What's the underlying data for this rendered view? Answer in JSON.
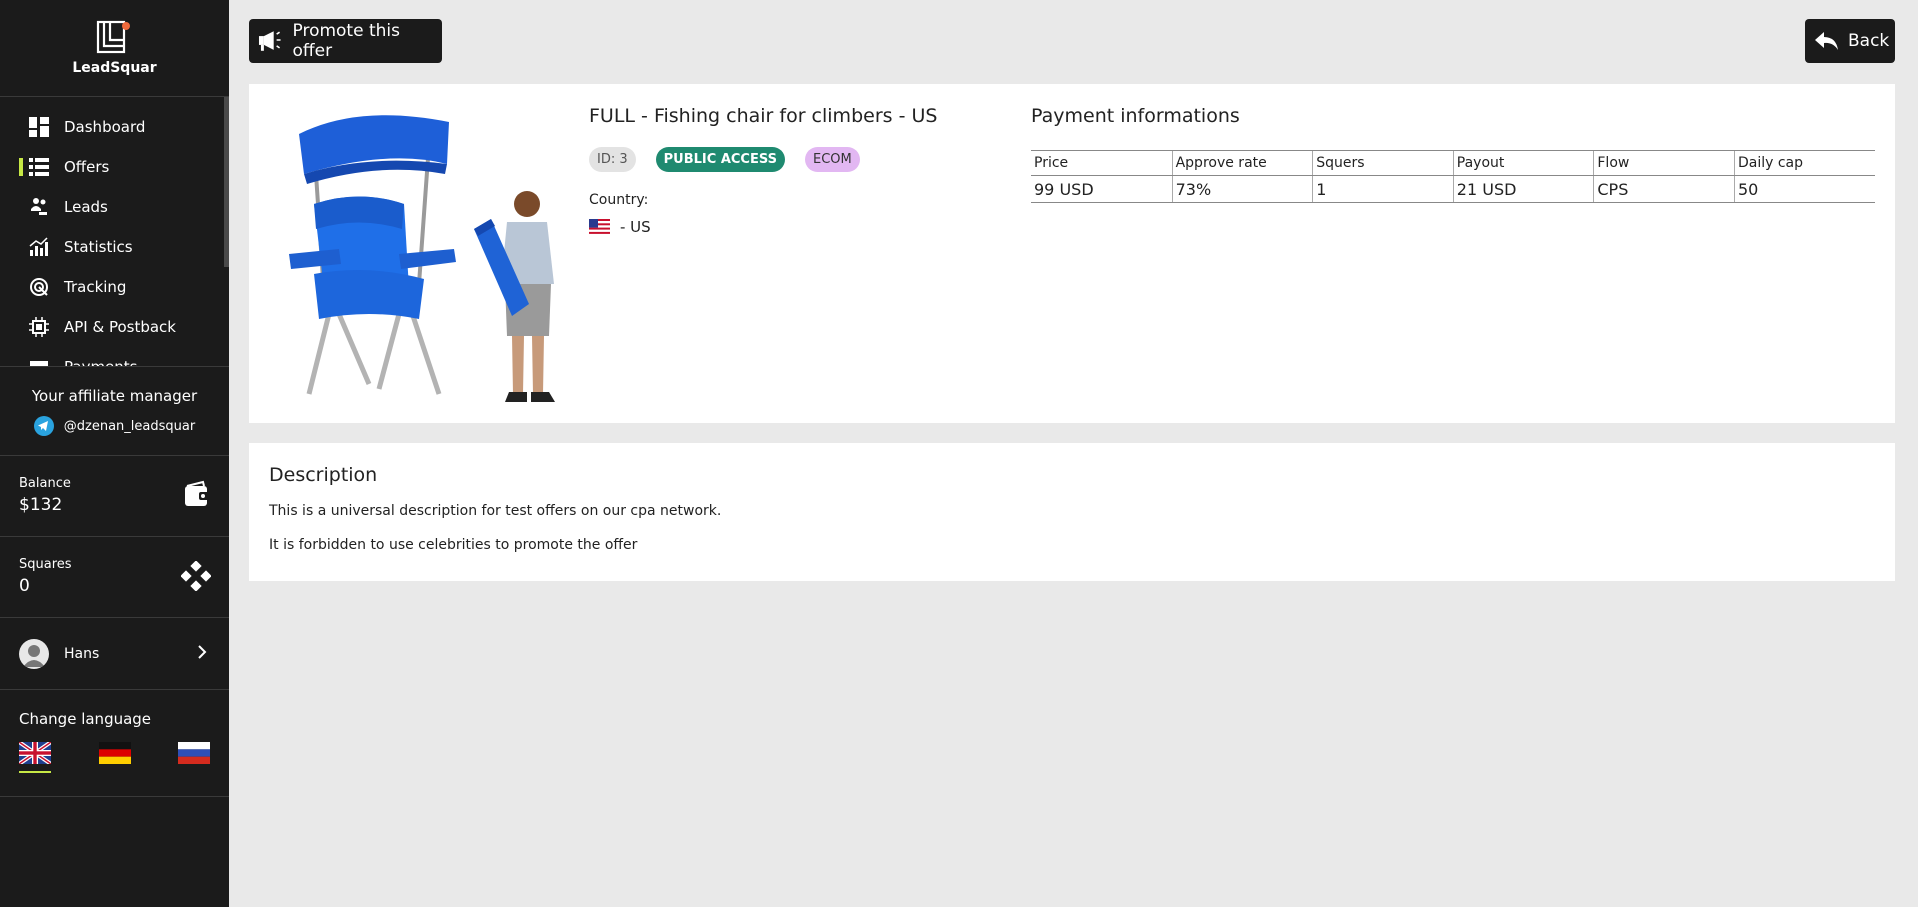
{
  "sidebar": {
    "brand": "LeadSquar",
    "nav": [
      {
        "label": "Dashboard",
        "icon": "dashboard-icon"
      },
      {
        "label": "Offers",
        "icon": "list-icon",
        "active": true
      },
      {
        "label": "Leads",
        "icon": "leads-icon"
      },
      {
        "label": "Statistics",
        "icon": "bar-chart-icon"
      },
      {
        "label": "Tracking",
        "icon": "tracking-icon"
      },
      {
        "label": "API & Postback",
        "icon": "api-icon"
      },
      {
        "label": "Payments",
        "icon": "payments-icon"
      }
    ],
    "manager": {
      "title": "Your affiliate manager",
      "contact": "@dzenan_leadsquar"
    },
    "balance": {
      "label": "Balance",
      "value": "$132"
    },
    "squares": {
      "label": "Squares",
      "value": "0"
    },
    "user": {
      "name": "Hans"
    },
    "language": {
      "title": "Change language",
      "options": [
        "en",
        "de",
        "ru"
      ],
      "active": "en"
    }
  },
  "toolbar": {
    "promote_label": "Promote this offer",
    "back_label": "Back"
  },
  "offer": {
    "title": "FULL - Fishing chair for climbers - US",
    "id_tag": "ID: 3",
    "access_tag": "PUBLIC ACCESS",
    "category_tag": "ECOM",
    "country_label": "Country:",
    "country_value": "- US"
  },
  "payment": {
    "title": "Payment informations",
    "headers": [
      "Price",
      "Approve rate",
      "Squers",
      "Payout",
      "Flow",
      "Daily cap"
    ],
    "values": [
      "99 USD",
      "73%",
      "1",
      "21 USD",
      "CPS",
      "50"
    ]
  },
  "description": {
    "title": "Description",
    "lines": [
      "This is a universal description for test offers on our cpa network.",
      "It is forbidden to use celebrities to promote the offer"
    ]
  },
  "colors": {
    "sidebar_bg": "#1b1b1b",
    "accent": "#c6e845",
    "public_access": "#1f8a70",
    "ecom_tag": "#e2b7f2",
    "telegram": "#2aa3df"
  }
}
